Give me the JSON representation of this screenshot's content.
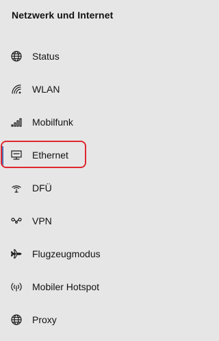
{
  "section": {
    "title": "Netzwerk und Internet"
  },
  "nav": {
    "items": [
      {
        "label": "Status",
        "icon": "globe-icon"
      },
      {
        "label": "WLAN",
        "icon": "wifi-icon"
      },
      {
        "label": "Mobilfunk",
        "icon": "cellular-signal-icon"
      },
      {
        "label": "Ethernet",
        "icon": "ethernet-icon",
        "selected": true
      },
      {
        "label": "DFÜ",
        "icon": "dial-up-icon"
      },
      {
        "label": "VPN",
        "icon": "vpn-icon"
      },
      {
        "label": "Flugzeugmodus",
        "icon": "airplane-icon"
      },
      {
        "label": "Mobiler Hotspot",
        "icon": "hotspot-icon"
      },
      {
        "label": "Proxy",
        "icon": "globe-icon"
      }
    ]
  },
  "colors": {
    "background": "#e6e6e6",
    "accent": "#4a6fb5",
    "highlight": "#e0262e"
  }
}
